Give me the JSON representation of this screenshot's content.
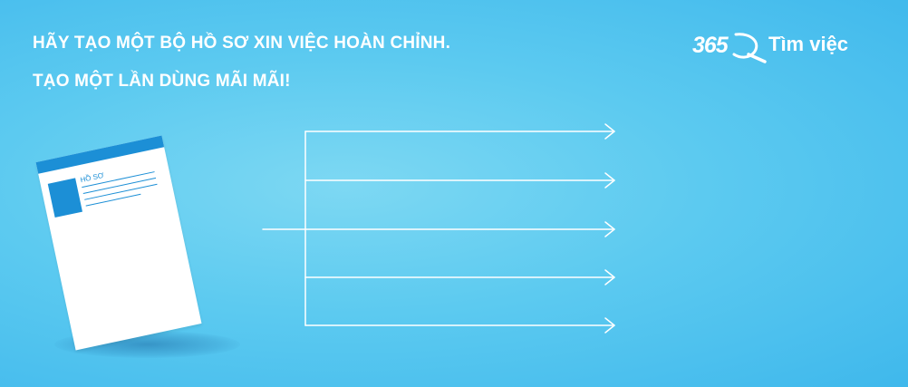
{
  "headline": {
    "line1": "HÃY TẠO MỘT BỘ HỒ SƠ XIN VIỆC HOÀN CHỈNH.",
    "line2": "TẠO MỘT LẦN DÙNG MÃI MÃI!"
  },
  "brand": {
    "number": "365",
    "name": "Tìm việc"
  },
  "document": {
    "label": "HỒ SƠ",
    "accent_color": "#1c8fd6"
  },
  "flow": {
    "branch_count": 5,
    "line_color": "#ffffff"
  },
  "background": {
    "light": "#7dd8f3",
    "dark": "#3fb8ec"
  }
}
